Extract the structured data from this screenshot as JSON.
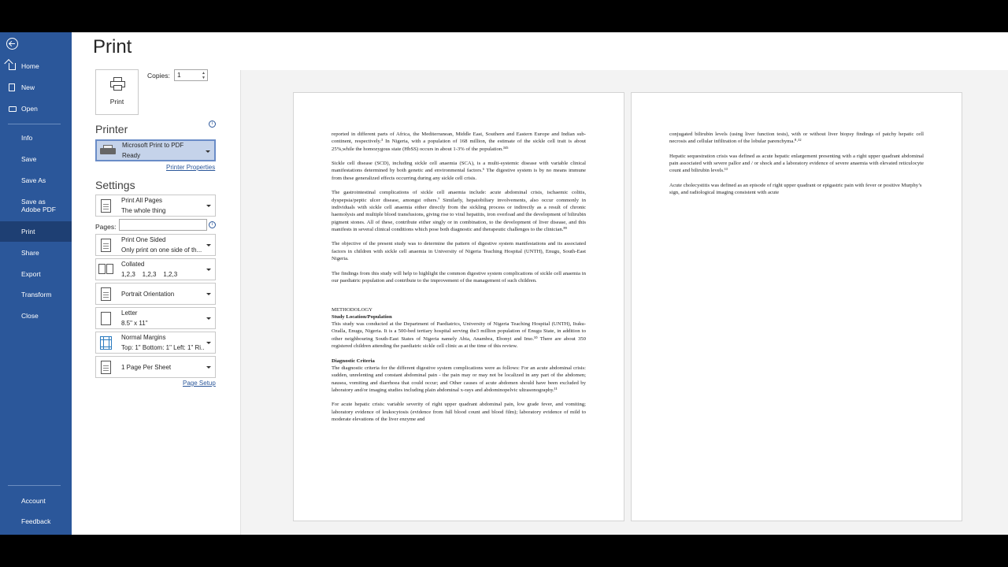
{
  "nav": {
    "items": [
      {
        "label": "Home"
      },
      {
        "label": "New"
      },
      {
        "label": "Open"
      },
      {
        "label": "Info"
      },
      {
        "label": "Save"
      },
      {
        "label": "Save As"
      },
      {
        "label": "Save as Adobe PDF"
      },
      {
        "label": "Print"
      },
      {
        "label": "Share"
      },
      {
        "label": "Export"
      },
      {
        "label": "Transform"
      },
      {
        "label": "Close"
      },
      {
        "label": "Account"
      },
      {
        "label": "Feedback"
      }
    ],
    "selected": "Print",
    "color": "#2b579a"
  },
  "print": {
    "title": "Print",
    "button_label": "Print",
    "copies_label": "Copies:",
    "copies_value": "1"
  },
  "printer": {
    "heading": "Printer",
    "name": "Microsoft Print to PDF",
    "status": "Ready",
    "properties_link": "Printer Properties"
  },
  "settings": {
    "heading": "Settings",
    "pages_range": {
      "l1": "Print All Pages",
      "l2": "The whole thing"
    },
    "pages_label": "Pages:",
    "pages_value": "",
    "sides": {
      "l1": "Print One Sided",
      "l2": "Only print on one side of th..."
    },
    "collation": {
      "l1": "Collated",
      "l2": "1,2,3    1,2,3    1,2,3"
    },
    "orientation": {
      "l1": "Portrait Orientation"
    },
    "paper": {
      "l1": "Letter",
      "l2": "8.5\" x 11\""
    },
    "margins": {
      "l1": "Normal Margins",
      "l2": "Top: 1\" Bottom: 1\" Left: 1\" Ri..."
    },
    "per_sheet": {
      "l1": "1 Page Per Sheet"
    },
    "page_setup_link": "Page Setup"
  },
  "preview": {
    "page1": [
      "reported in different parts of Africa, the Mediterranean, Middle East, Southern and Eastern Europe and Indian sub-continent, respectively.³ In Nigeria, with a population of 168 million, the estimate of the sickle cell trait is about 25%,while the homozygous state (HbSS) occurs in about 1-3% of the population.³⁴⁵",
      "Sickle cell disease (SCD), including sickle cell anaemia (SCA), is a multi-systemic disease with variable clinical manifestations determined by both genetic and environmental factors.⁶ The digestive system is by no means immune from these generalized effects occurring during any sickle cell crisis.",
      "The gastrointestinal complications of sickle cell anaemia include: acute abdominal crisis, ischaemic colitis, dyspepsia/peptic ulcer disease, amongst others.⁷ Similarly, hepatobiliary involvements, also occur commonly in individuals with sickle cell anaemia either directly from the sickling process or indirectly as a result of chronic haemolysis and multiple blood transfusions, giving rise to viral hepatitis, iron overload and the development of bilirubin pigment stones. All of these, contribute either singly or in combination, to the development of liver disease, and this manifests in several clinical conditions which pose both diagnostic and therapeutic challenges to the clinician.⁸⁹",
      "The objective of the present study was to determine the pattern of digestive system manifestations and its associated factors in children with sickle cell anaemia in University of Nigeria Teaching Hospital (UNTH), Enugu, South-East Nigeria.",
      "The findings from this study will help to highlight the common digestive system complications of sickle cell anaemia in our paediatric population and contribute to the improvement of the management of such children."
    ],
    "methodology": "METHODOLOGY",
    "study_heading": "Study Location/Population",
    "study_text": "This study was conducted at the Department of Paediatrics, University of Nigeria Teaching Hospital (UNTH), Ituku-Ozalla, Enugu, Nigeria. It is a 500-bed tertiary hospital serving the3 million population of Enugu State, in addition to other neighbouring South-East States of Nigeria namely Abia, Anambra, Ebonyi and Imo.¹⁰ There are about 350 registered children attending the paediatric sickle cell clinic as at the time of this review.",
    "criteria_heading": "Diagnostic Criteria",
    "criteria_text": "The diagnostic criteria for the different digestive system complications were as follows: For an acute abdominal crisis: sudden, unrelenting and constant abdominal pain - the pain may or may not be localized in any part of the abdomen; nausea, vomiting and diarrhoea that could occur; and Other causes of acute abdomen should have been excluded by laboratory and/or imaging studies including plain abdominal x-rays and abdominopelvic ultrasonography.¹¹",
    "hepatic_text": "For acute hepatic crisis: variable severity of right upper quadrant abdominal pain, low grade fever, and vomiting; laboratory evidence of leukocytosis (evidence from full blood count and blood film); laboratory evidence of mild to moderate elevations of the liver enzyme and",
    "page2": [
      "conjugated bilirubin levels (using liver function tests), with or without liver biopsy findings of patchy hepatic cell necrosis and cellular infiltration of the lobular parenchyma.⁸·¹²",
      "Hepatic sequestration crisis was defined as acute hepatic enlargement presenting with a right upper quadrant abdominal pain associated with severe pallor and / or shock and a laboratory evidence of severe anaemia with elevated reticulocyte count and bilirubin levels.¹³",
      "Acute cholecystitis was defined as  an episode of right upper quadrant or epigastric pain with fever or positive Murphy’s sign, and radiological imaging consistent with acute"
    ]
  }
}
